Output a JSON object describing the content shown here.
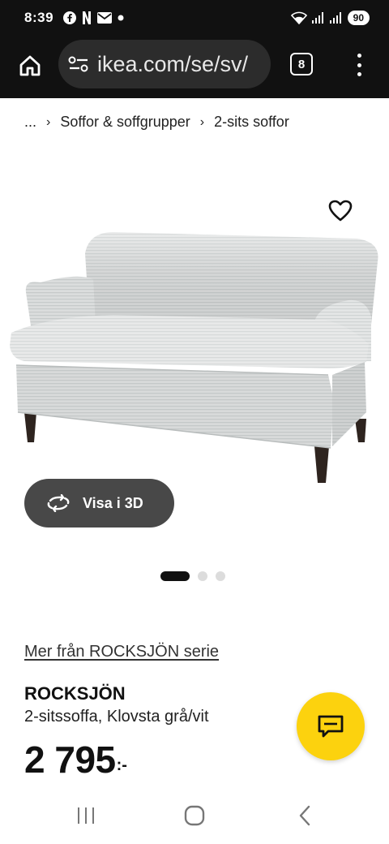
{
  "status_bar": {
    "time": "8:39",
    "battery": "90",
    "notification_icons": [
      "facebook-icon",
      "netflix-icon",
      "mail-icon",
      "dot-icon"
    ]
  },
  "browser": {
    "url": "ikea.com/se/sv/",
    "tab_count": "8"
  },
  "breadcrumb": {
    "items": [
      "...",
      "Soffor & soffgrupper",
      "2-sits soffor"
    ]
  },
  "gallery": {
    "button_3d_label": "Visa i 3D",
    "active_index": 0,
    "total": 3
  },
  "product": {
    "series_link": "Mer från ROCKSJÖN serie",
    "brand": "ROCKSJÖN",
    "description": "2-sitssoffa, Klovsta grå/vit",
    "price": "2 795",
    "price_suffix": ":-"
  },
  "colors": {
    "accent_yellow": "#fcd20e",
    "dark_button": "#484848",
    "browser_bar": "#111111"
  }
}
